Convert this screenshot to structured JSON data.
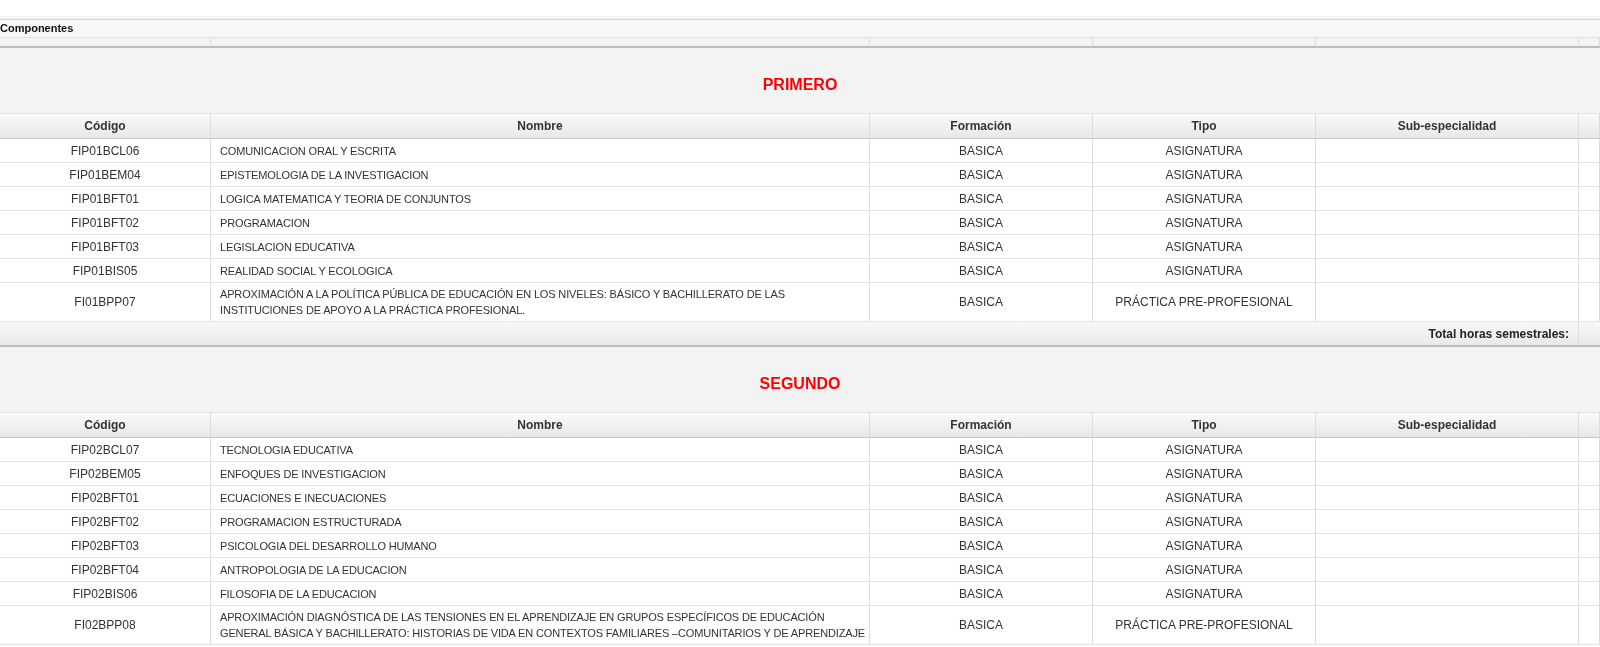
{
  "panel": {
    "title": "Componentes"
  },
  "sections": [
    {
      "title": "PRIMERO",
      "columns": [
        "Código",
        "Nombre",
        "Formación",
        "Tipo",
        "Sub-especialidad"
      ],
      "total_label": "Total horas semestrales:",
      "rows": [
        {
          "code": "FIP01BCL06",
          "name": "COMUNICACION ORAL Y ESCRITA",
          "formation": "BASICA",
          "type": "ASIGNATURA"
        },
        {
          "code": "FIP01BEM04",
          "name": "EPISTEMOLOGIA DE LA INVESTIGACION",
          "formation": "BASICA",
          "type": "ASIGNATURA"
        },
        {
          "code": "FIP01BFT01",
          "name": "LOGICA MATEMATICA Y TEORIA DE CONJUNTOS",
          "formation": "BASICA",
          "type": "ASIGNATURA"
        },
        {
          "code": "FIP01BFT02",
          "name": "PROGRAMACION",
          "formation": "BASICA",
          "type": "ASIGNATURA"
        },
        {
          "code": "FIP01BFT03",
          "name": "LEGISLACION EDUCATIVA",
          "formation": "BASICA",
          "type": "ASIGNATURA"
        },
        {
          "code": "FIP01BIS05",
          "name": "REALIDAD SOCIAL Y ECOLOGICA",
          "formation": "BASICA",
          "type": "ASIGNATURA"
        },
        {
          "code": "FI01BPP07",
          "name": "APROXIMACIÓN A LA POLÍTICA PÚBLICA DE EDUCACIÓN EN LOS NIVELES: BÁSICO Y BACHILLERATO DE LAS INSTITUCIONES DE APOYO A LA PRÁCTICA PROFESIONAL.",
          "formation": "BASICA",
          "type": "PRÁCTICA PRE-PROFESIONAL"
        }
      ]
    },
    {
      "title": "SEGUNDO",
      "columns": [
        "Código",
        "Nombre",
        "Formación",
        "Tipo",
        "Sub-especialidad"
      ],
      "rows": [
        {
          "code": "FIP02BCL07",
          "name": "TECNOLOGIA EDUCATIVA",
          "formation": "BASICA",
          "type": "ASIGNATURA"
        },
        {
          "code": "FIP02BEM05",
          "name": "ENFOQUES DE INVESTIGACION",
          "formation": "BASICA",
          "type": "ASIGNATURA"
        },
        {
          "code": "FIP02BFT01",
          "name": "ECUACIONES E INECUACIONES",
          "formation": "BASICA",
          "type": "ASIGNATURA"
        },
        {
          "code": "FIP02BFT02",
          "name": "PROGRAMACION ESTRUCTURADA",
          "formation": "BASICA",
          "type": "ASIGNATURA"
        },
        {
          "code": "FIP02BFT03",
          "name": "PSICOLOGIA DEL DESARROLLO HUMANO",
          "formation": "BASICA",
          "type": "ASIGNATURA"
        },
        {
          "code": "FIP02BFT04",
          "name": "ANTROPOLOGIA DE LA EDUCACION",
          "formation": "BASICA",
          "type": "ASIGNATURA"
        },
        {
          "code": "FIP02BIS06",
          "name": "FILOSOFIA DE LA EDUCACION",
          "formation": "BASICA",
          "type": "ASIGNATURA"
        },
        {
          "code": "FI02BPP08",
          "name": "APROXIMACIÓN DIAGNÓSTICA DE LAS TENSIONES EN EL APRENDIZAJE EN GRUPOS ESPECÍFICOS DE EDUCACIÓN GENERAL BÁSICA Y BACHILLERATO: HISTORIAS DE VIDA EN CONTEXTOS FAMILIARES –COMUNITARIOS Y DE APRENDIZAJE",
          "formation": "BASICA",
          "type": "PRÁCTICA PRE-PROFESIONAL"
        }
      ]
    }
  ]
}
